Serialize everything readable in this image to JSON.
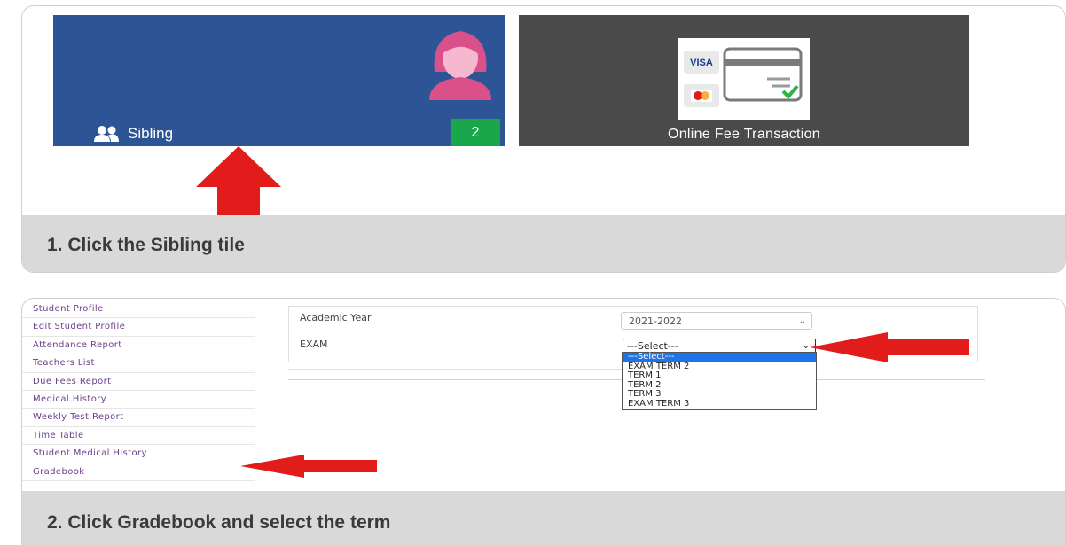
{
  "step1": {
    "sibling_tile": {
      "label": "Sibling",
      "count": "2"
    },
    "fee_tile": {
      "label": "Online Fee Transaction",
      "card_brand": "VISA"
    },
    "caption": "1. Click the Sibling tile"
  },
  "step2": {
    "menu": [
      "Student Profile",
      "Edit Student Profile",
      "Attendance Report",
      "Teachers List",
      "Due Fees Report",
      "Medical History",
      "Weekly Test Report",
      "Time Table",
      "Student Medical History",
      "Gradebook"
    ],
    "form": {
      "academic_year_label": "Academic Year",
      "academic_year_value": "2021-2022",
      "exam_label": "EXAM",
      "exam_value": "---Select---"
    },
    "exam_options": [
      "---Select---",
      "EXAM TERM 2",
      "TERM 1",
      "TERM 2",
      "TERM 3",
      "EXAM TERM 3"
    ],
    "caption": "2. Click Gradebook and select the term"
  },
  "colors": {
    "sibling_tile": "#2d5596",
    "fee_tile": "#4a4a4a",
    "count_badge": "#1aa64a",
    "arrow": "#e21b1b",
    "caption_bg": "#d9d9d9",
    "selected_option": "#1e73e8"
  }
}
